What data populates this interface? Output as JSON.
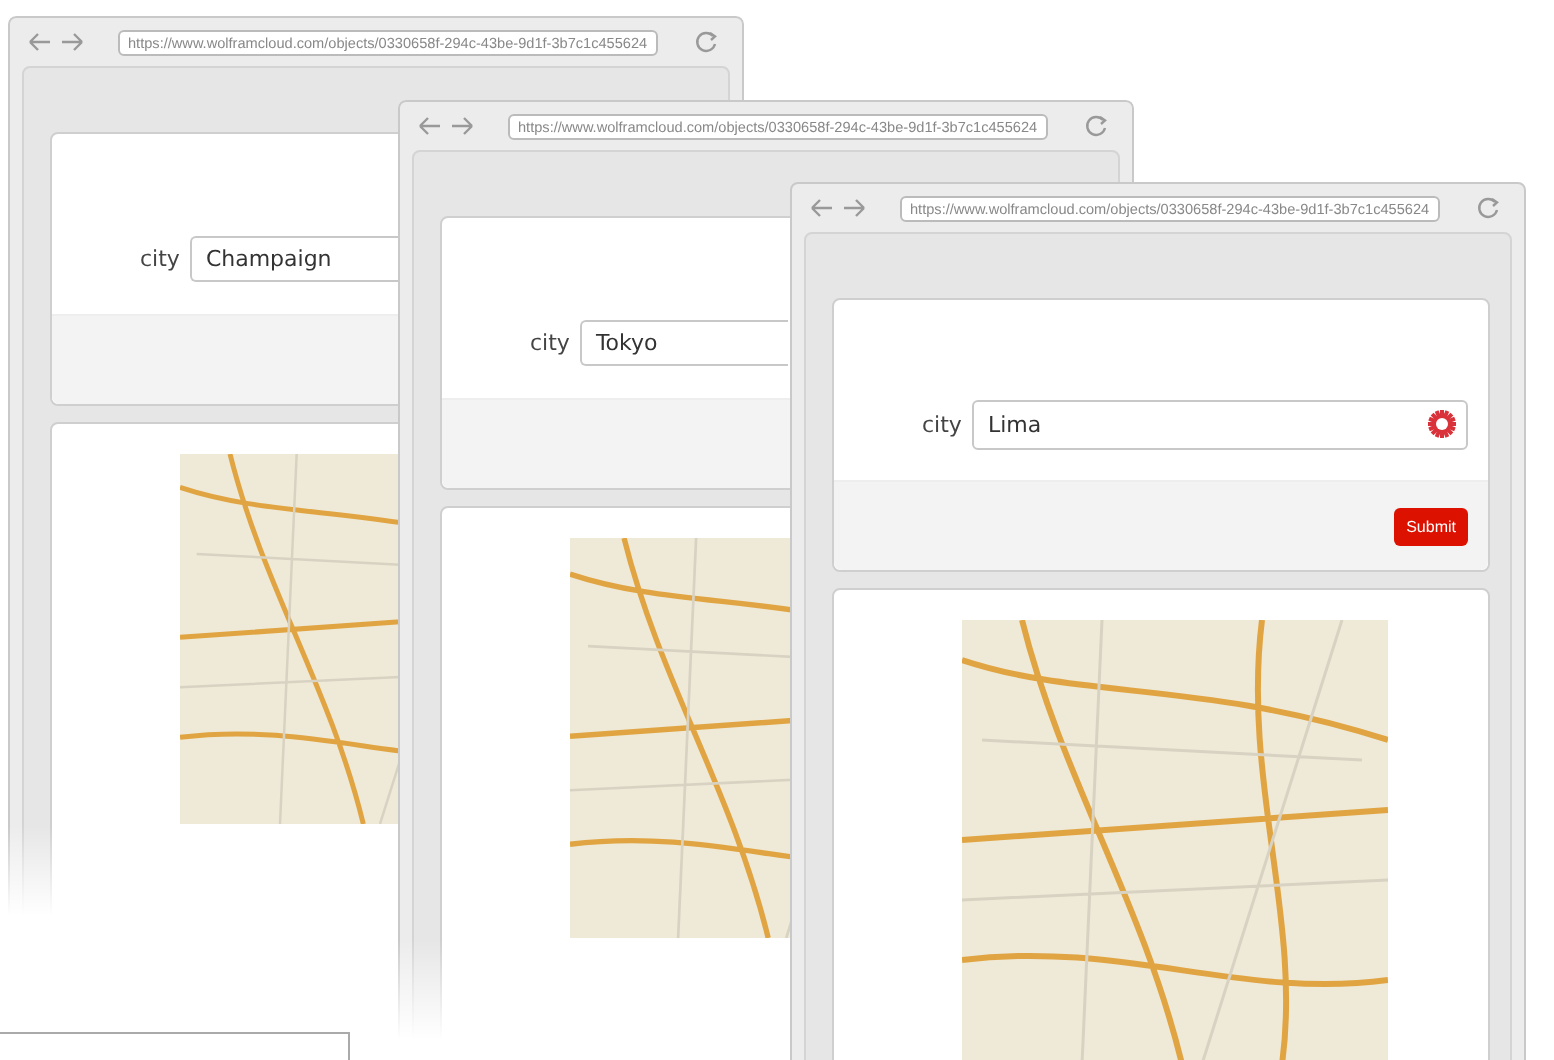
{
  "windows": [
    {
      "url": "https://www.wolframcloud.com/objects/0330658f-294c-43be-9d1f-3b7c1c455624",
      "field_label": "city",
      "value": "Champaign"
    },
    {
      "url": "https://www.wolframcloud.com/objects/0330658f-294c-43be-9d1f-3b7c1c455624",
      "field_label": "city",
      "value": "Tokyo"
    },
    {
      "url": "https://www.wolframcloud.com/objects/0330658f-294c-43be-9d1f-3b7c1c455624",
      "field_label": "city",
      "value": "Lima",
      "input_icon": true,
      "submit": "Submit"
    }
  ]
}
